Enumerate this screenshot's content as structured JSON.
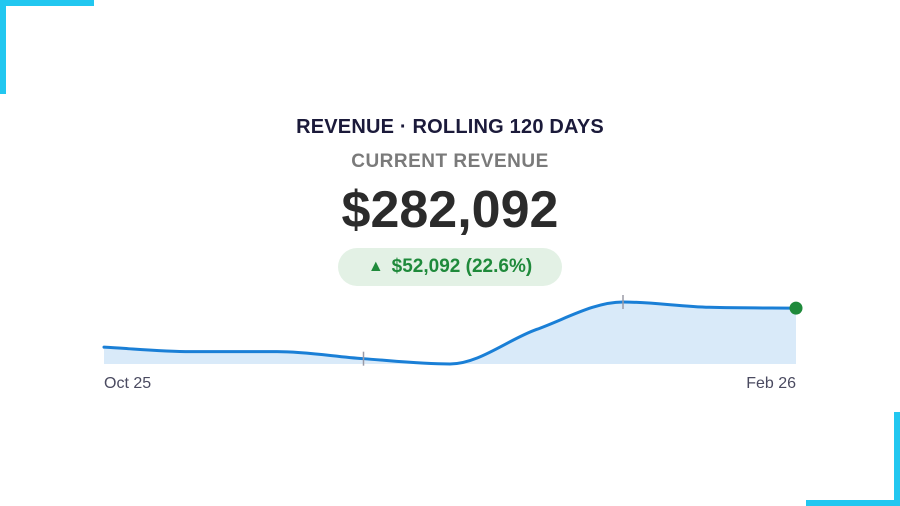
{
  "header": {
    "title": "REVENUE · ROLLING 120 DAYS"
  },
  "kpi": {
    "label": "CURRENT REVENUE",
    "value": "$282,092",
    "delta_arrow": "▲",
    "delta_text": "$52,092 (22.6%)"
  },
  "colors": {
    "accent": "#22c7f0",
    "line": "#1a7fd6",
    "area": "#d9eaf9",
    "positive": "#1f8a3b",
    "positive_bg": "#e3f1e5",
    "end_marker": "#1f8a3b"
  },
  "chart_data": {
    "type": "area",
    "x_start_label": "Oct 25",
    "x_end_label": "Feb 26",
    "x": [
      0,
      15,
      30,
      45,
      60,
      75,
      90,
      105,
      120
    ],
    "values": [
      238000,
      233000,
      233000,
      225000,
      219000,
      258000,
      289000,
      283000,
      282092
    ],
    "x_ticks": [
      36,
      65
    ],
    "ylim": [
      219000,
      289000
    ],
    "end_marker": true,
    "grid": false
  }
}
